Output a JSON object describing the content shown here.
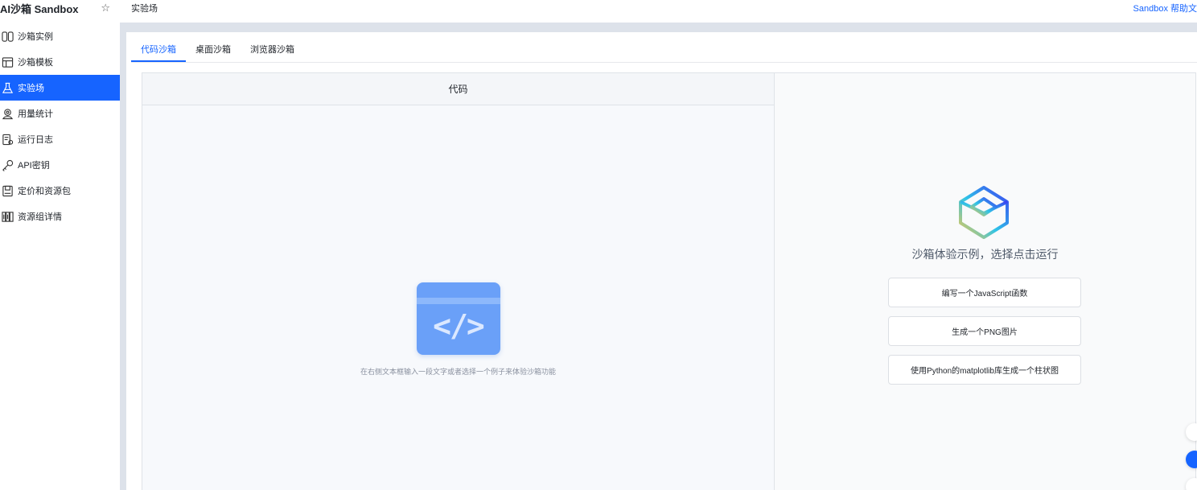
{
  "app": {
    "title": "AI沙箱 Sandbox",
    "favorite_icon": "star-icon"
  },
  "sidebar": {
    "items": [
      {
        "label": "沙箱实例",
        "icon": "instances-icon",
        "active": false
      },
      {
        "label": "沙箱模板",
        "icon": "template-icon",
        "active": false
      },
      {
        "label": "实验场",
        "icon": "flask-icon",
        "active": true
      },
      {
        "label": "用量统计",
        "icon": "usage-icon",
        "active": false
      },
      {
        "label": "运行日志",
        "icon": "log-icon",
        "active": false
      },
      {
        "label": "API密钥",
        "icon": "key-icon",
        "active": false
      },
      {
        "label": "定价和资源包",
        "icon": "pricing-icon",
        "active": false
      },
      {
        "label": "资源组详情",
        "icon": "resource-group-icon",
        "active": false
      }
    ]
  },
  "header": {
    "breadcrumb": "实验场",
    "help_link": "Sandbox 帮助文"
  },
  "tabs": [
    {
      "label": "代码沙箱",
      "active": true
    },
    {
      "label": "桌面沙箱",
      "active": false
    },
    {
      "label": "浏览器沙箱",
      "active": false
    }
  ],
  "code_panel": {
    "title": "代码",
    "icon": "code-icon",
    "glyph": "</>",
    "hint": "在右侧文本框输入一段文字或者选择一个例子来体验沙箱功能"
  },
  "run_panel": {
    "logo": "sandbox-cube-logo",
    "title": "沙箱体验示例，选择点击运行",
    "examples": [
      "编写一个JavaScript函数",
      "生成一个PNG图片",
      "使用Python的matplotlib库生成一个柱状图"
    ]
  },
  "colors": {
    "accent": "#1664ff",
    "code_icon": "#6aa0f8",
    "page_bg": "#dde2ea"
  }
}
